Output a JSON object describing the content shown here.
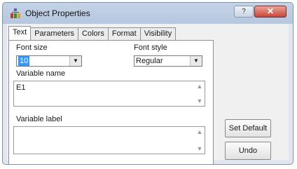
{
  "window": {
    "title": "Object Properties",
    "help_glyph": "?",
    "close_glyph": "✕"
  },
  "tabs": [
    {
      "label": "Text",
      "active": true
    },
    {
      "label": "Parameters",
      "active": false
    },
    {
      "label": "Colors",
      "active": false
    },
    {
      "label": "Format",
      "active": false
    },
    {
      "label": "Visibility",
      "active": false
    }
  ],
  "text_tab": {
    "font_size_label": "Font size",
    "font_size_value": "10",
    "font_style_label": "Font style",
    "font_style_value": "Regular",
    "variable_name_label": "Variable name",
    "variable_name_value": "E1",
    "variable_label_label": "Variable label",
    "variable_label_value": ""
  },
  "buttons": {
    "set_default": "Set Default",
    "undo": "Undo"
  },
  "colors": {
    "selection": "#3399ff",
    "close_button": "#c8463a",
    "titlebar": "#c4d3e6"
  }
}
